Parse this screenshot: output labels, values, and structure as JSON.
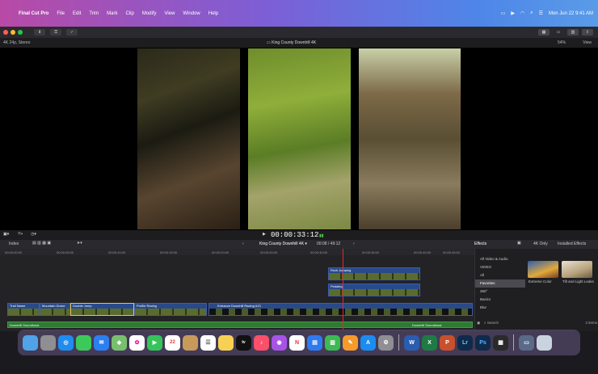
{
  "menubar": {
    "app": "Final Cut Pro",
    "items": [
      "File",
      "Edit",
      "Trim",
      "Mark",
      "Clip",
      "Modify",
      "View",
      "Window",
      "Help"
    ],
    "datetime": "Mon Jun 22  9:41 AM"
  },
  "toolbar": {
    "btn1": "⬇",
    "btn2": "⚿",
    "btn3": "✓"
  },
  "viewer": {
    "format": "4K 24p, Stereo",
    "title": "King County Downhill 4K",
    "zoom": "54%",
    "view_label": "View"
  },
  "playback": {
    "timecode": "00:00:33:12"
  },
  "timeline_header": {
    "index": "Index",
    "project": "King County Downhill 4K",
    "position": "00:08 / 49:12",
    "effects": "Effects",
    "k4_only": "4K Only",
    "installed": "Installed Effects"
  },
  "ruler": [
    "00:00:00:00",
    "00:00:05:00",
    "00:00:10:00",
    "00:00:15:00",
    "00:00:20:00",
    "00:00:25:00",
    "00:00:30:00",
    "00:00:35:00",
    "00:00:40:00",
    "00:00:45:00"
  ],
  "clips": {
    "c1": "Trail Name",
    "c2": "Mountain Drone",
    "c3": "Double Jump",
    "c4": "Profile Racing",
    "c5": "Entrance Downhill Racing #13",
    "c6": "Rock Jumping",
    "c7": "Pedaling"
  },
  "audio": {
    "left": "Downhill Soundtrack",
    "right": "Downhill Soundtrack"
  },
  "effects_panel": {
    "categories": [
      "All Video & Audio",
      "VIDEO",
      "All",
      "Favorites",
      "360°",
      "Basics",
      "Blur"
    ],
    "fx1": "Extreme Color",
    "fx2": "Tilt and Light Leaks",
    "search": "Search",
    "count": "2 items"
  },
  "dock": {
    "cal_day": "22",
    "tv": "tv"
  }
}
